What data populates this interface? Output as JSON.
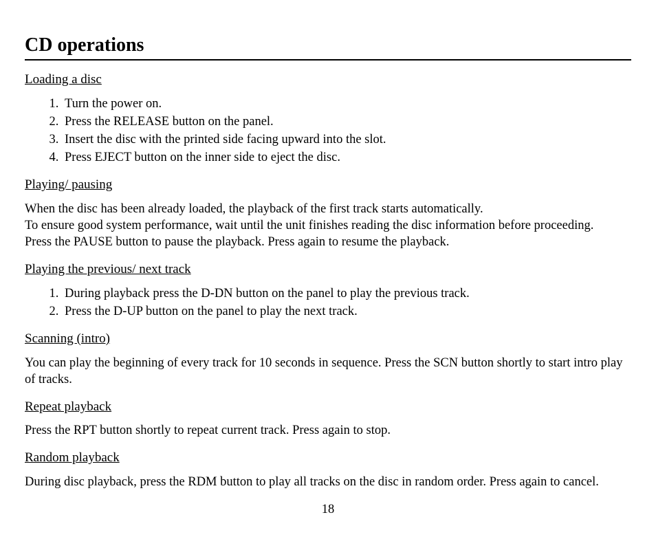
{
  "title": "CD operations",
  "sections": {
    "loading": {
      "heading": "Loading a disc",
      "items": [
        "Turn the power on.",
        "Press the RELEASE button on the panel.",
        "Insert the disc with the printed side facing upward into the slot.",
        "Press EJECT button on the inner side to eject the disc."
      ]
    },
    "playing": {
      "heading": "Playing/ pausing",
      "paragraphs": [
        "When the disc has been already loaded, the playback of the first track starts automatically.",
        "To ensure good system performance, wait until the unit finishes reading the disc information before proceeding.",
        "Press the PAUSE button to pause the playback. Press again to resume the playback."
      ]
    },
    "prevnext": {
      "heading": "Playing the previous/ next track",
      "items": [
        "During playback press the D-DN button on the panel to play the previous track.",
        "Press the D-UP button on the panel to play the next track."
      ]
    },
    "scanning": {
      "heading": "Scanning (intro)",
      "paragraph": "You can play the beginning of every track for 10 seconds in sequence. Press the SCN button shortly to start intro play of tracks."
    },
    "repeat": {
      "heading": "Repeat playback",
      "paragraph": "Press the RPT button shortly to repeat current track. Press again to stop."
    },
    "random": {
      "heading": "Random playback",
      "paragraph": "During disc playback, press the RDM button to play all tracks on the disc in random order. Press again to cancel."
    }
  },
  "page_number": "18"
}
